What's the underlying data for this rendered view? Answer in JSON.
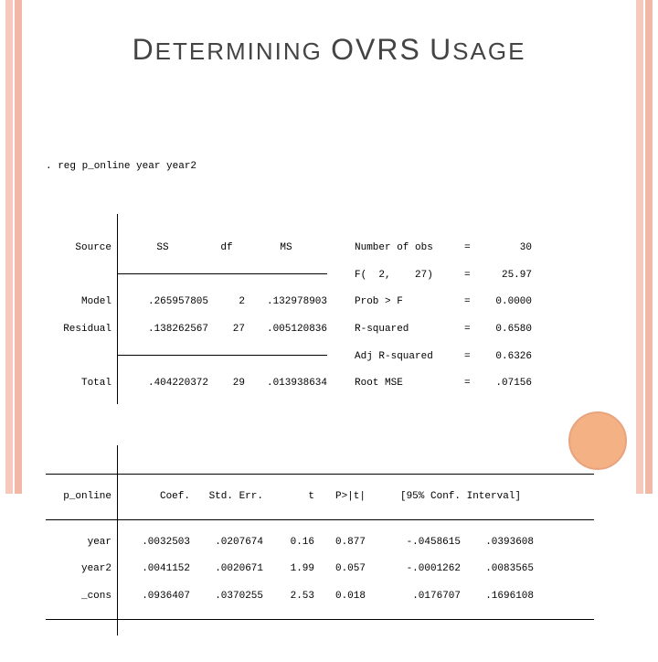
{
  "title": {
    "word1_cap": "D",
    "word1_rest": "ETERMINING",
    "word2": "OVRS",
    "word3_cap": "U",
    "word3_rest": "SAGE"
  },
  "command": ". reg p_online year year2",
  "anova": {
    "header": {
      "source": "Source",
      "ss": "SS",
      "df": "df",
      "ms": "MS"
    },
    "rows": [
      {
        "source": "Model",
        "ss": ".265957805",
        "df": "2",
        "ms": ".132978903"
      },
      {
        "source": "Residual",
        "ss": ".138262567",
        "df": "27",
        "ms": ".005120836"
      }
    ],
    "total": {
      "source": "Total",
      "ss": ".404220372",
      "df": "29",
      "ms": ".013938634"
    }
  },
  "stats": [
    {
      "label": "Number of obs",
      "eq": "=",
      "value": "30"
    },
    {
      "label": "F(  2,    27)",
      "eq": "=",
      "value": "25.97"
    },
    {
      "label": "Prob > F",
      "eq": "=",
      "value": "0.0000"
    },
    {
      "label": "R-squared",
      "eq": "=",
      "value": "0.6580"
    },
    {
      "label": "Adj R-squared",
      "eq": "=",
      "value": "0.6326"
    },
    {
      "label": "Root MSE",
      "eq": "=",
      "value": ".07156"
    }
  ],
  "coef": {
    "depvar": "p_online",
    "header": {
      "coef": "Coef.",
      "se": "Std. Err.",
      "t": "t",
      "p": "P>|t|",
      "ci": "[95% Conf. Interval]"
    },
    "rows": [
      {
        "var": "year",
        "coef": ".0032503",
        "se": ".0207674",
        "t": "0.16",
        "p": "0.877",
        "cil": "-.0458615",
        "cih": ".0393608"
      },
      {
        "var": "year2",
        "coef": ".0041152",
        "se": ".0020671",
        "t": "1.99",
        "p": "0.057",
        "cil": "-.0001262",
        "cih": ".0083565"
      },
      {
        "var": "_cons",
        "coef": ".0936407",
        "se": ".0370255",
        "t": "2.53",
        "p": "0.018",
        "cil": ".0176707",
        "cih": ".1696108"
      }
    ]
  }
}
